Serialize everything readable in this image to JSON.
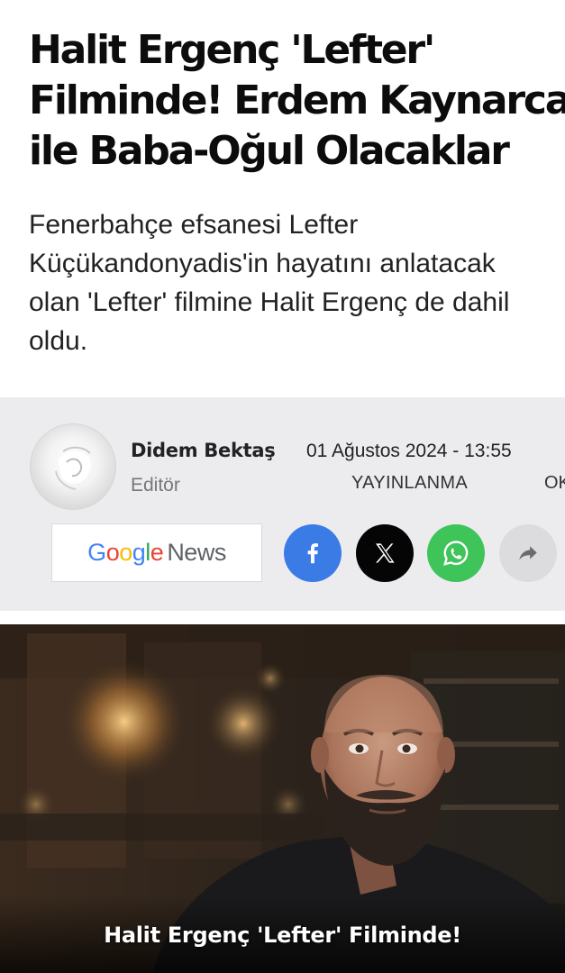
{
  "article": {
    "headline": "Halit Ergenç 'Lefter'\nFilminde! Erdem Kaynarca\nile Baba-Oğul Olacaklar",
    "summary": "Fenerbahçe efsanesi Lefter\nKüçükandonyadis'in hayatını anlatacak\nolan 'Lefter' filmine Halit Ergenç de dahil\noldu."
  },
  "author": {
    "name": "Didem Bektaş",
    "role": "Editör",
    "avatar_icon": "avatar-photo"
  },
  "publication": {
    "date": "01 Ağustos 2024 - 13:55",
    "label": "YAYINLANMA",
    "extra_label": "OKUMA"
  },
  "actions": {
    "google_news": {
      "google": [
        "G",
        "o",
        "o",
        "g",
        "l",
        "e"
      ],
      "google_colors": [
        "#4285F4",
        "#EA4335",
        "#FBBC05",
        "#4285F4",
        "#34A853",
        "#EA4335"
      ],
      "news": "News"
    },
    "share_buttons": [
      {
        "icon": "facebook-icon",
        "color": "#3b7be6"
      },
      {
        "icon": "x-icon",
        "color": "#050505"
      },
      {
        "icon": "whatsapp-icon",
        "color": "#3fc45a"
      },
      {
        "icon": "share-arrow-icon",
        "color": "#dcdcde"
      }
    ]
  },
  "hero": {
    "caption": "Halit Ergenç 'Lefter' Filminde!"
  }
}
